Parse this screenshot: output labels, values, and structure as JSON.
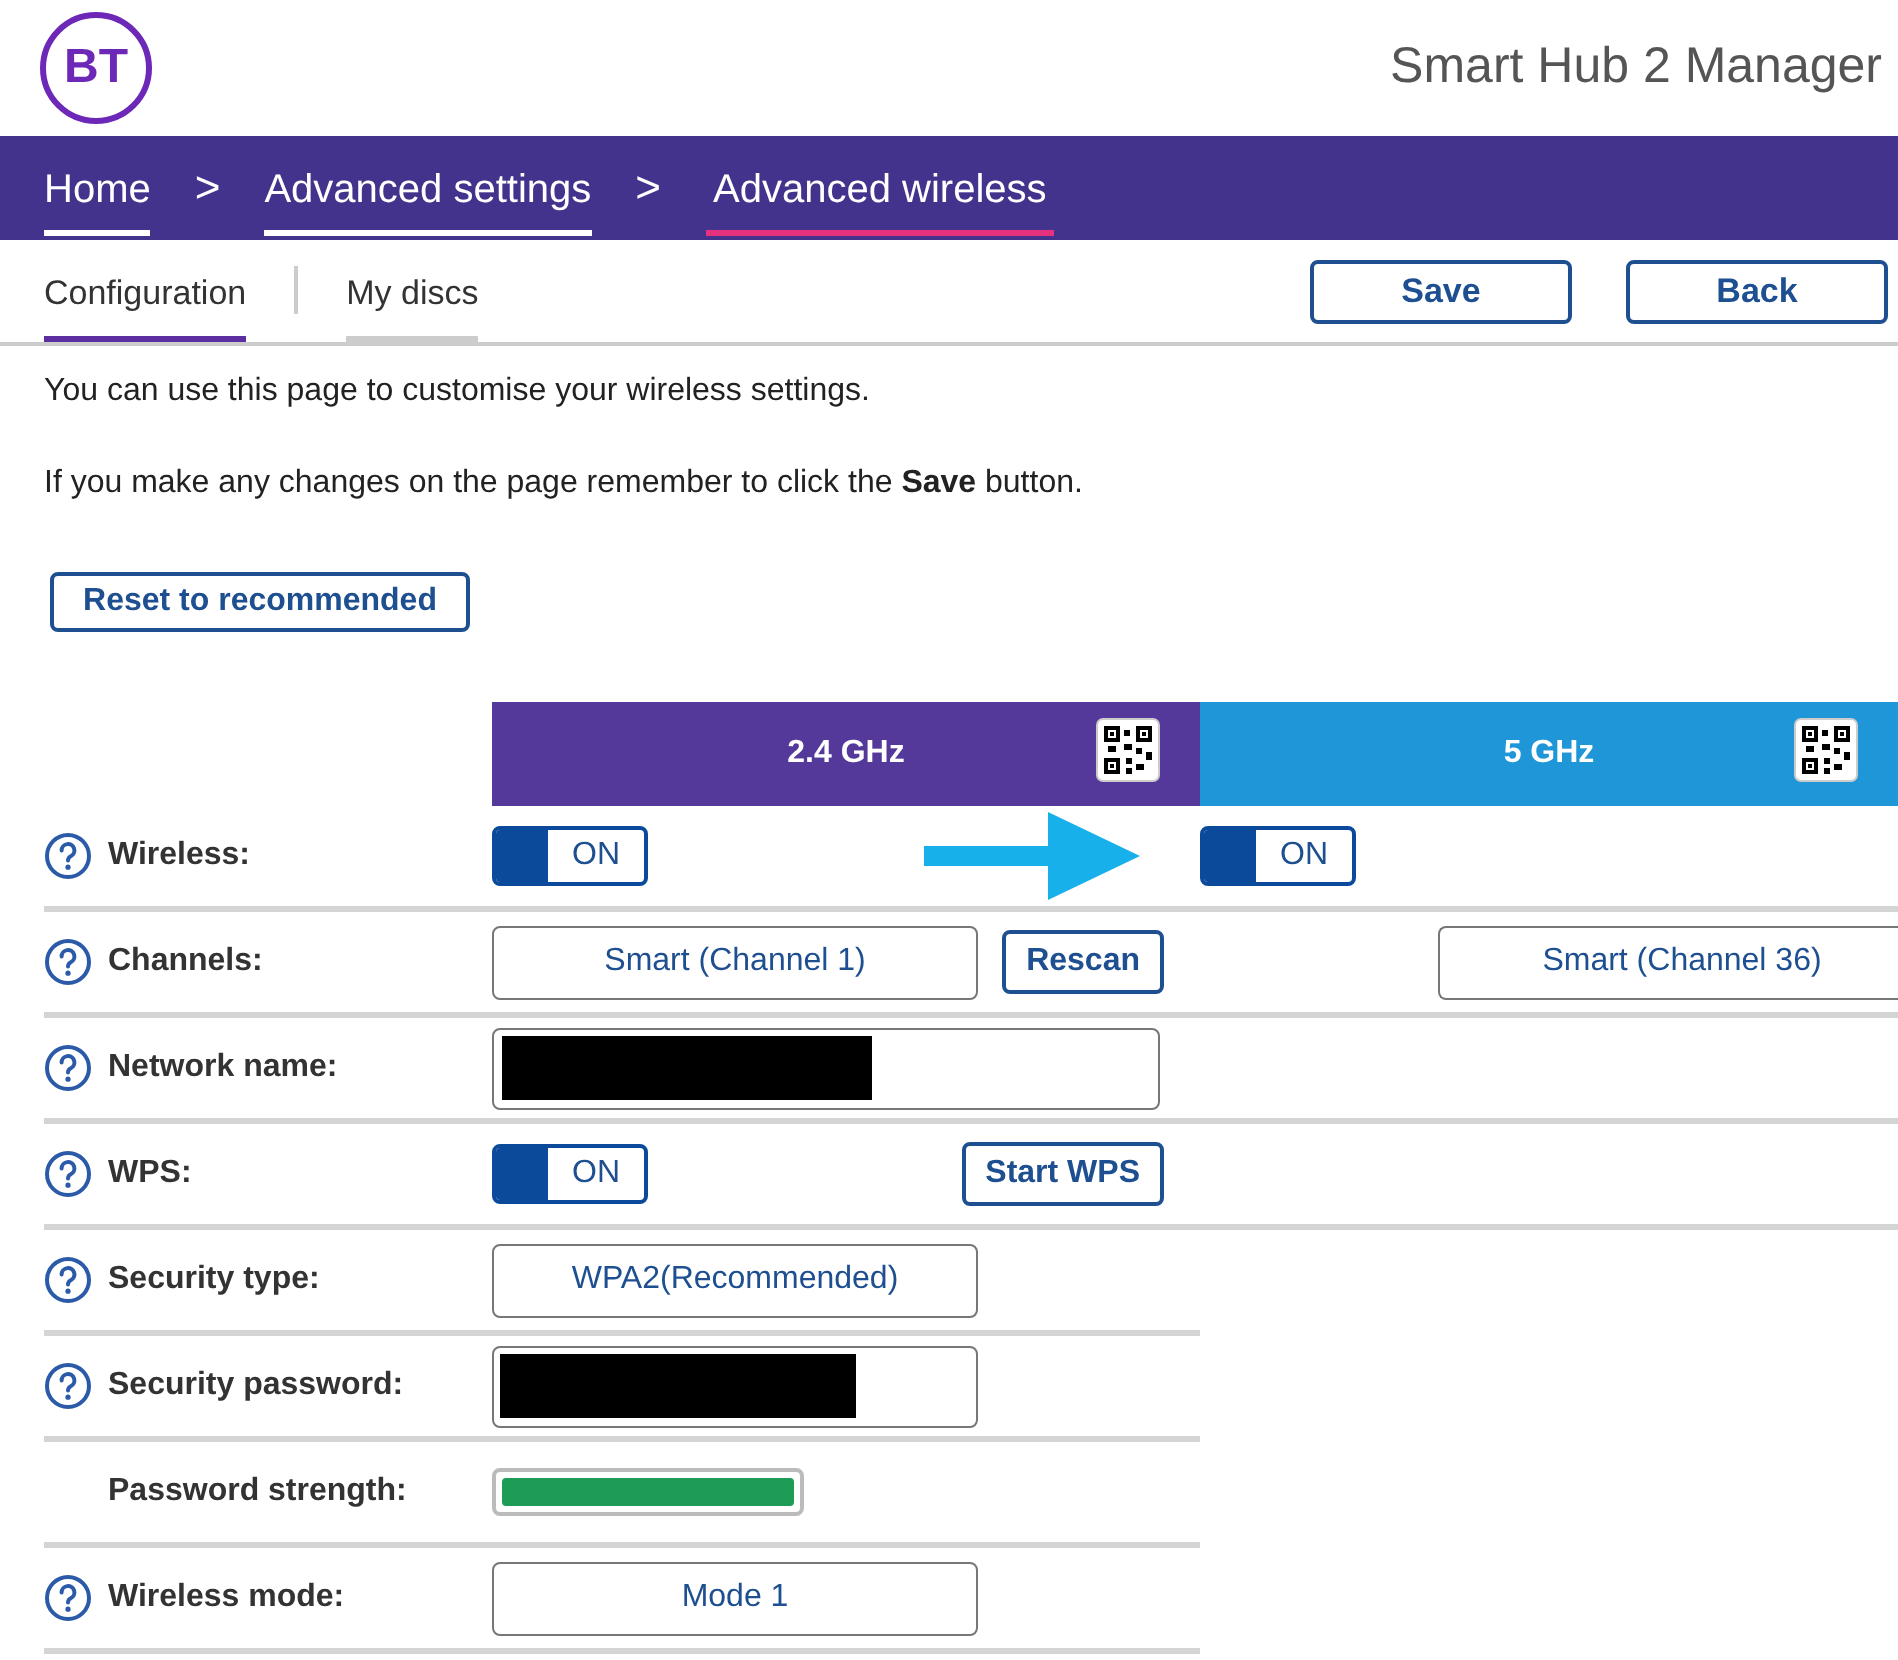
{
  "header": {
    "logo": "BT",
    "title": "Smart Hub 2 Manager"
  },
  "breadcrumb": [
    {
      "label": "Home",
      "selected": false
    },
    {
      "label": "Advanced settings",
      "selected": false
    },
    {
      "label": "Advanced wireless",
      "selected": true
    }
  ],
  "breadcrumb_separator": ">",
  "tabs": [
    {
      "label": "Configuration",
      "selected": true
    },
    {
      "label": "My discs",
      "selected": false
    }
  ],
  "actions": [
    "Save",
    "Back"
  ],
  "intro": "You can use this page to customise your wireless settings.",
  "note": "If you make any changes on the page remember to click the **Save** button.",
  "reset_button": "Reset to recommended",
  "bands": [
    {
      "label": "2.4 GHz",
      "color": "#55399a"
    },
    {
      "label": "5 GHz",
      "color": "#1e96d8"
    }
  ],
  "rows": [
    {
      "label": "Wireless:",
      "help": true,
      "full_width_divider": true,
      "band_24": [
        {
          "kind": "toggle",
          "on": true,
          "text": "ON"
        }
      ],
      "band_5": [
        {
          "kind": "toggle",
          "on": true,
          "text": "ON"
        }
      ]
    },
    {
      "label": "Channels:",
      "help": true,
      "full_width_divider": true,
      "band_24": [
        {
          "kind": "select",
          "value": "Smart (Channel 1)"
        },
        {
          "kind": "button",
          "label": "Rescan"
        }
      ],
      "band_5": [
        {
          "kind": "select",
          "value": "Smart (Channel 36)"
        }
      ]
    },
    {
      "label": "Network name:",
      "help": true,
      "full_width_divider": true,
      "band_24": [
        {
          "kind": "redacted_input"
        }
      ],
      "band_5": []
    },
    {
      "label": "WPS:",
      "help": true,
      "full_width_divider": true,
      "band_24": [
        {
          "kind": "toggle",
          "on": true,
          "text": "ON"
        },
        {
          "kind": "button",
          "label": "Start WPS"
        }
      ],
      "band_5": []
    },
    {
      "label": "Security type:",
      "help": true,
      "full_width_divider": false,
      "band_24": [
        {
          "kind": "select",
          "value": "WPA2(Recommended)"
        }
      ],
      "band_5": []
    },
    {
      "label": "Security password:",
      "help": true,
      "full_width_divider": false,
      "band_24": [
        {
          "kind": "redacted_password"
        }
      ],
      "band_5": []
    },
    {
      "label": "Password strength:",
      "help": false,
      "full_width_divider": false,
      "band_24": [
        {
          "kind": "strength",
          "level": 1.0,
          "color": "#1e9c55"
        }
      ],
      "band_5": []
    },
    {
      "label": "Wireless mode:",
      "help": true,
      "full_width_divider": false,
      "band_24": [
        {
          "kind": "select",
          "value": "Mode 1"
        }
      ],
      "band_5": []
    }
  ]
}
